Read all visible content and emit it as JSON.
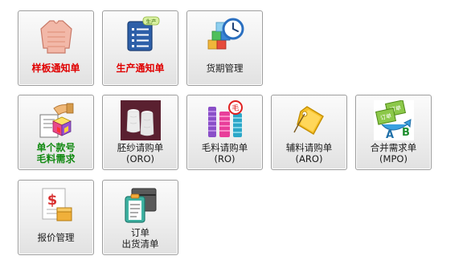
{
  "tiles": [
    {
      "lines": [
        "样板通知单"
      ],
      "icon": "sweater-icon",
      "style": "red"
    },
    {
      "lines": [
        "生产通知单"
      ],
      "icon": "production-list-icon",
      "badge": "生产",
      "style": "red"
    },
    {
      "lines": [
        "货期管理"
      ],
      "icon": "blocks-clock-icon",
      "style": "normal"
    },
    {
      "lines": [
        "单个款号",
        "毛料需求"
      ],
      "icon": "cube-hand-document-icon",
      "style": "green"
    },
    {
      "lines": [
        "胚纱请购单",
        "(ORO)"
      ],
      "icon": "yarn-spools-icon",
      "style": "normal"
    },
    {
      "lines": [
        "毛料请购单",
        "(RO)"
      ],
      "icon": "colored-spools-icon",
      "style": "normal"
    },
    {
      "lines": [
        "辅料请购单",
        "(ARO)"
      ],
      "icon": "accessory-tag-icon",
      "style": "normal"
    },
    {
      "lines": [
        "合并需求单",
        "(MPO)"
      ],
      "icon": "merge-orders-icon",
      "badge_text": "订单",
      "badge_a": "A",
      "badge_b": "B",
      "style": "normal"
    },
    {
      "lines": [
        "报价管理"
      ],
      "icon": "quote-dollar-icon",
      "style": "normal"
    },
    {
      "lines": [
        "订单",
        "出货清单"
      ],
      "icon": "shipping-clipboard-icon",
      "style": "normal"
    }
  ]
}
